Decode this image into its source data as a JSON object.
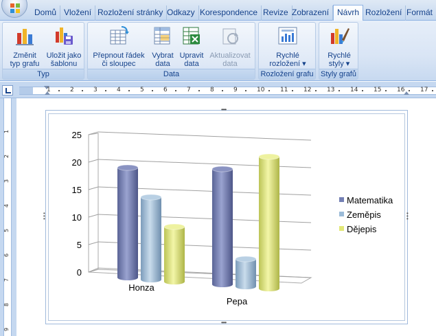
{
  "tabs": [
    {
      "label": "Domů"
    },
    {
      "label": "Vložení"
    },
    {
      "label": "Rozložení stránky"
    },
    {
      "label": "Odkazy"
    },
    {
      "label": "Korespondence"
    },
    {
      "label": "Revize"
    },
    {
      "label": "Zobrazení"
    },
    {
      "label": "Návrh"
    },
    {
      "label": "Rozložení"
    },
    {
      "label": "Formát"
    }
  ],
  "ribbon": {
    "groups": {
      "typ": "Typ",
      "data": "Data",
      "rozlozeni": "Rozložení grafu",
      "styly": "Styly grafů"
    },
    "buttons": {
      "zmenit": "Změnit\ntyp grafu",
      "ulozit": "Uložit jako\nšablonu",
      "prepnout": "Přepnout řádek\nči sloupec",
      "vybrat": "Vybrat\ndata",
      "upravit": "Upravit\ndata",
      "aktualizovat": "Aktualizovat\ndata",
      "rychle_rozlozeni": "Rychlé\nrozložení ▾",
      "rychle_styly": "Rychlé\nstyly ▾"
    }
  },
  "colors": {
    "series_matematika": "#7480b4",
    "series_zemepis": "#9bbbd8",
    "series_dejepis": "#e2e878"
  },
  "chart_data": {
    "type": "bar",
    "subtype": "3d-clustered-cylinder",
    "categories": [
      "Honza",
      "Pepa"
    ],
    "series": [
      {
        "name": "Matematika",
        "values": [
          20,
          21
        ]
      },
      {
        "name": "Zeměpis",
        "values": [
          15,
          5
        ]
      },
      {
        "name": "Dějepis",
        "values": [
          10,
          24
        ]
      }
    ],
    "yticks": [
      "0",
      "5",
      "10",
      "15",
      "20",
      "25"
    ],
    "ylim": [
      0,
      25
    ],
    "grid": true,
    "legend": "right"
  }
}
